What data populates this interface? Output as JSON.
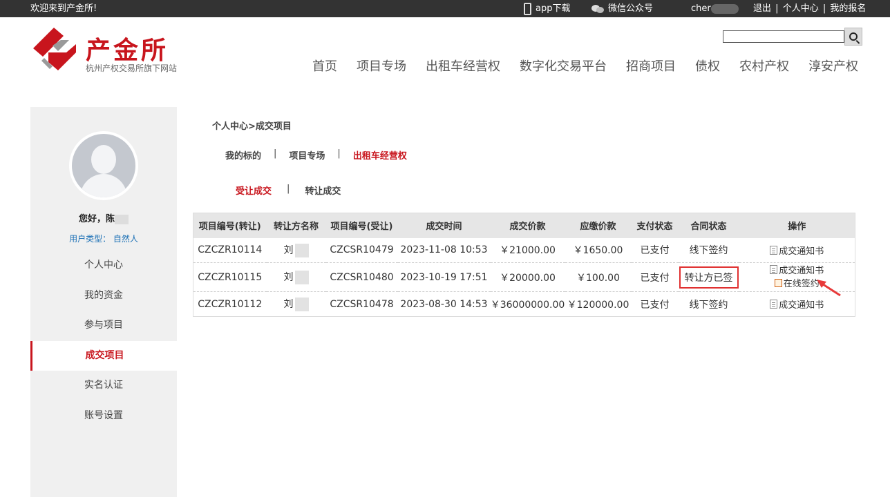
{
  "topbar": {
    "welcome": "欢迎来到产金所!",
    "app_download": "app下载",
    "wechat": "微信公众号",
    "username": "cher",
    "logout": "退出",
    "personal_center": "个人中心",
    "my_signups": "我的报名",
    "separator": "|"
  },
  "logo": {
    "title": "产金所",
    "subtitle": "杭州产权交易所旗下网站"
  },
  "search": {
    "placeholder": ""
  },
  "nav": [
    "首页",
    "项目专场",
    "出租车经营权",
    "数字化交易平台",
    "招商项目",
    "债权",
    "农村产权",
    "淳安产权"
  ],
  "sidebar": {
    "greeting": "您好，陈",
    "user_type": "用户类型：  自然人",
    "items": [
      "个人中心",
      "我的资金",
      "参与项目",
      "成交项目",
      "实名认证",
      "账号设置"
    ],
    "active_index": 3
  },
  "breadcrumb": "个人中心>成交项目",
  "tabs_top": [
    "我的标的",
    "项目专场",
    "出租车经营权"
  ],
  "tabs_top_active": 2,
  "tabs_sub": [
    "受让成交",
    "转让成交"
  ],
  "tabs_sub_active": 0,
  "tab_separator": "|",
  "table": {
    "headers": [
      "项目编号(转让)",
      "转让方名称",
      "项目编号(受让)",
      "成交时间",
      "成交价款",
      "应缴价款",
      "支付状态",
      "合同状态",
      "操作"
    ],
    "rows": [
      {
        "transfer_no": "CZCZR10114",
        "transferor": "刘",
        "receive_no": "CZCSR10479",
        "time": "2023-11-08 10:53",
        "price": "￥21000.00",
        "payable": "￥1650.00",
        "pay_status": "已支付",
        "contract_status": "线下签约",
        "ops": [
          "成交通知书"
        ]
      },
      {
        "transfer_no": "CZCZR10115",
        "transferor": "刘",
        "receive_no": "CZCSR10480",
        "time": "2023-10-19 17:51",
        "price": "￥20000.00",
        "payable": "￥100.00",
        "pay_status": "已支付",
        "contract_status": "转让方已签",
        "ops": [
          "成交通知书",
          "在线签约"
        ]
      },
      {
        "transfer_no": "CZCZR10112",
        "transferor": "刘",
        "receive_no": "CZCSR10478",
        "time": "2023-08-30 14:53",
        "price": "￥36000000.00",
        "payable": "￥120000.00",
        "pay_status": "已支付",
        "contract_status": "线下签约",
        "ops": [
          "成交通知书"
        ]
      }
    ]
  },
  "colors": {
    "brand": "#c8151d",
    "paid": "#3a9b2e",
    "link": "#1a6fb5",
    "highlight_box": "#e03030"
  }
}
